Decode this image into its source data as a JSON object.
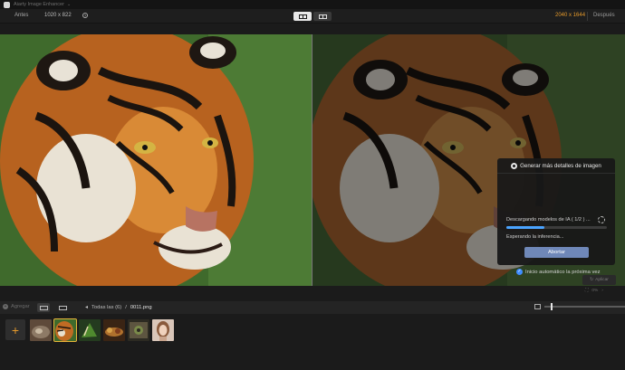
{
  "window": {
    "title": "Aiarty Image Enhancer"
  },
  "toolbar": {
    "before_label": "Antes",
    "input_size": "1020 x 822",
    "info_icon": "info-circle-icon",
    "output_size": "2040 x 1644",
    "after_label": "Después",
    "colors": {
      "output_size": "#e59a2b"
    }
  },
  "dialog": {
    "title": "Generar más detalles de imagen",
    "downloading": "Descargando modelos de IA ( 1/2 ) ...",
    "waiting": "Esperando la inferencia...",
    "cancel": "Abortar",
    "progress": 0.38,
    "accent": "#4aa3ff"
  },
  "auto_start": {
    "label": "Inicio automático la próxima vez",
    "checked": true
  },
  "mini_panel": {
    "label": "Aplicar",
    "zoom": "0%"
  },
  "bottombar": {
    "add_label": "Agregar",
    "all_label": "Todas las (6)",
    "separator": "/",
    "filename": "0011.png"
  },
  "filmstrip": {
    "add_symbol": "+",
    "items": [
      {
        "name": "wolf"
      },
      {
        "name": "tiger",
        "selected": true
      },
      {
        "name": "leaves"
      },
      {
        "name": "feast"
      },
      {
        "name": "wall"
      },
      {
        "name": "portrait"
      }
    ]
  }
}
